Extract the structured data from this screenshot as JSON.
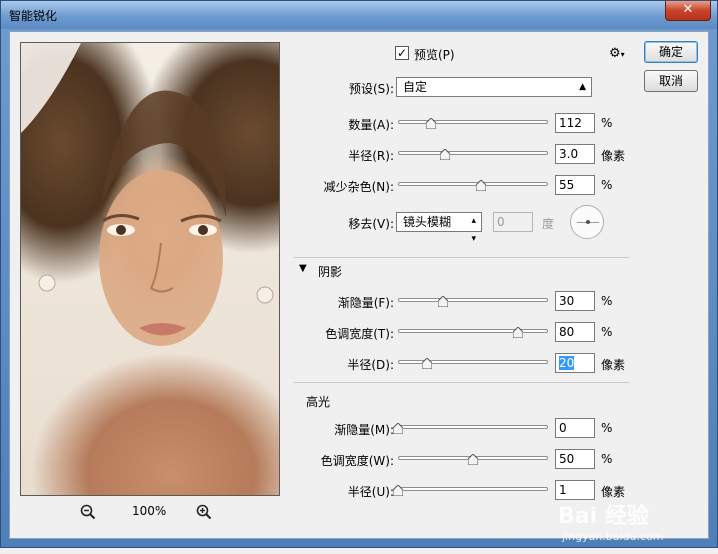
{
  "window": {
    "title": "智能锐化",
    "close_label": "✕"
  },
  "buttons": {
    "ok": "确定",
    "cancel": "取消"
  },
  "preview": {
    "checkbox_label": "预览(P)",
    "checked": true,
    "zoom": "100%"
  },
  "preset": {
    "label": "预设(S):",
    "value": "自定"
  },
  "main_controls": [
    {
      "label": "数量(A):",
      "value": "112",
      "unit": "%",
      "level": 0.22
    },
    {
      "label": "半径(R):",
      "value": "3.0",
      "unit": "像素",
      "level": 0.31
    },
    {
      "label": "减少杂色(N):",
      "value": "55",
      "unit": "%",
      "level": 0.55
    }
  ],
  "remove": {
    "label": "移去(V):",
    "value": "镜头模糊",
    "angle_value": "0",
    "angle_unit": "度"
  },
  "shadow": {
    "title": "阴影",
    "controls": [
      {
        "label": "渐隐量(F):",
        "value": "30",
        "unit": "%",
        "level": 0.3
      },
      {
        "label": "色调宽度(T):",
        "value": "80",
        "unit": "%",
        "level": 0.8
      },
      {
        "label": "半径(D):",
        "value": "20",
        "unit": "像素",
        "level": 0.19,
        "selected": true
      }
    ]
  },
  "highlight": {
    "title": "高光",
    "controls": [
      {
        "label": "渐隐量(M):",
        "value": "0",
        "unit": "%",
        "level": 0.0
      },
      {
        "label": "色调宽度(W):",
        "value": "50",
        "unit": "%",
        "level": 0.5
      },
      {
        "label": "半径(U):",
        "value": "1",
        "unit": "像素",
        "level": 0.0
      }
    ]
  },
  "watermark": {
    "brand": "Bai 经验",
    "url": "jingyan.baidu.com"
  },
  "icons": {
    "gear": "gear-icon",
    "zoom_out": "zoom-out-icon",
    "zoom_in": "zoom-in-icon",
    "triangle": "collapse-triangle-icon"
  }
}
